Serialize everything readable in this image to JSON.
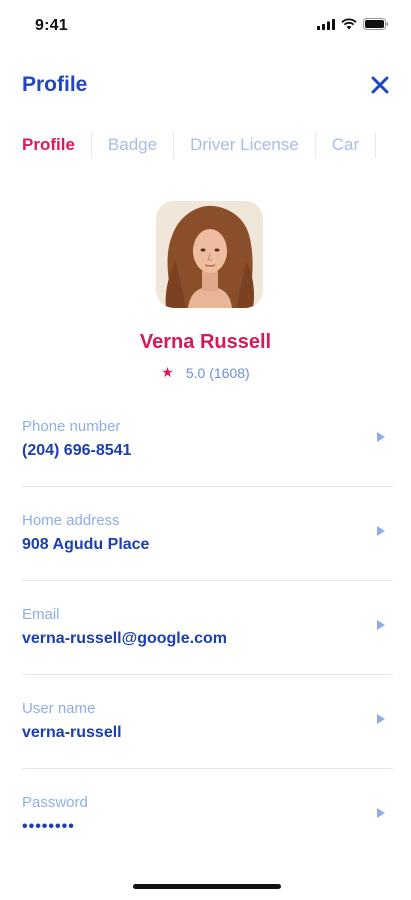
{
  "status": {
    "time": "9:41"
  },
  "header": {
    "title": "Profile"
  },
  "tabs": [
    {
      "label": "Profile",
      "active": true
    },
    {
      "label": "Badge",
      "active": false
    },
    {
      "label": "Driver License",
      "active": false
    },
    {
      "label": "Car",
      "active": false
    }
  ],
  "profile": {
    "name": "Verna Russell",
    "rating": "5.0 (1608)"
  },
  "fields": [
    {
      "label": "Phone number",
      "value": "(204) 696-8541"
    },
    {
      "label": "Home address",
      "value": "908 Agudu Place"
    },
    {
      "label": "Email",
      "value": "verna-russell@google.com"
    },
    {
      "label": "User name",
      "value": "verna-russell"
    },
    {
      "label": "Password",
      "value": "••••••••"
    }
  ],
  "colors": {
    "primary": "#1f46c4",
    "accent": "#e0195a",
    "muted": "#8faee6"
  }
}
